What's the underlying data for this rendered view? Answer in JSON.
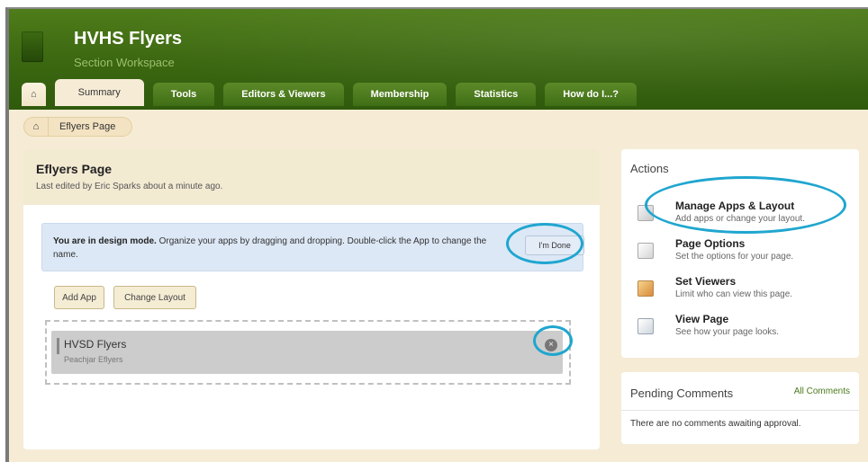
{
  "header": {
    "title": "HVHS Flyers",
    "subtitle": "Section Workspace"
  },
  "tabs": [
    {
      "label": "Summary"
    },
    {
      "label": "Tools"
    },
    {
      "label": "Editors & Viewers"
    },
    {
      "label": "Membership"
    },
    {
      "label": "Statistics"
    },
    {
      "label": "How do I...?"
    }
  ],
  "breadcrumb": {
    "current": "Eflyers Page"
  },
  "main": {
    "title": "Eflyers Page",
    "last_edited": "Last edited by Eric Sparks about a minute ago.",
    "design_mode_bold": "You are in design mode.",
    "design_mode_text": " Organize your apps by dragging and dropping. Double-click the App to change the name.",
    "done_label": "I'm Done",
    "add_app_label": "Add App",
    "change_layout_label": "Change Layout",
    "app": {
      "title": "HVSD Flyers",
      "subtitle": "Peachjar Eflyers"
    }
  },
  "actions": {
    "title": "Actions",
    "items": [
      {
        "title": "Manage Apps & Layout",
        "desc": "Add apps or change your layout.",
        "icon": "manage-apps-icon"
      },
      {
        "title": "Page Options",
        "desc": "Set the options for your page.",
        "icon": "page-options-icon"
      },
      {
        "title": "Set Viewers",
        "desc": "Limit who can view this page.",
        "icon": "set-viewers-icon"
      },
      {
        "title": "View Page",
        "desc": "See how your page looks.",
        "icon": "view-page-icon"
      }
    ]
  },
  "comments": {
    "title": "Pending Comments",
    "all_label": "All Comments",
    "empty_text": "There are no comments awaiting approval."
  },
  "colors": {
    "header_green": "#3e6a12",
    "callout_blue": "#1fa6cf",
    "design_banner": "#dde8f6"
  }
}
